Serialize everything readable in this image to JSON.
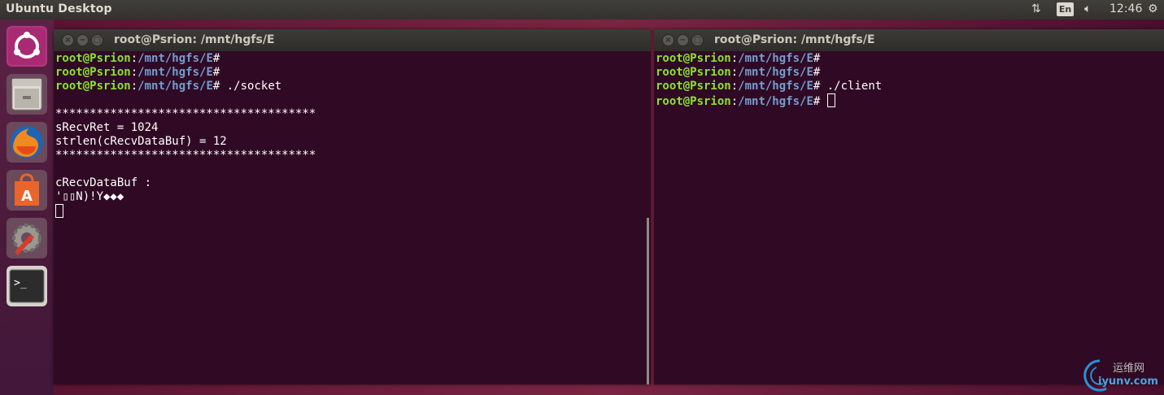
{
  "topbar": {
    "title": "Ubuntu Desktop",
    "keyboard_layout": "En",
    "clock": "12:46",
    "icons": [
      "network-arrows-icon",
      "volume-icon",
      "gear-icon"
    ]
  },
  "launcher": {
    "items": [
      {
        "name": "ubuntu-dash-icon"
      },
      {
        "name": "files-icon"
      },
      {
        "name": "firefox-icon"
      },
      {
        "name": "software-center-icon"
      },
      {
        "name": "system-settings-icon"
      },
      {
        "name": "terminal-icon"
      }
    ]
  },
  "left_terminal": {
    "title": "root@Psrion: /mnt/hgfs/E",
    "prompt_user": "root@Psrion",
    "prompt_sep": ":",
    "prompt_path": "/mnt/hgfs/E",
    "prompt_end": "#",
    "lines": [
      {
        "prompt": true,
        "cmd": ""
      },
      {
        "prompt": true,
        "cmd": ""
      },
      {
        "prompt": true,
        "cmd": " ./socket"
      },
      {
        "prompt": false,
        "text": ""
      },
      {
        "prompt": false,
        "text": "**************************************"
      },
      {
        "prompt": false,
        "text": "sRecvRet = 1024"
      },
      {
        "prompt": false,
        "text": "strlen(cRecvDataBuf) = 12"
      },
      {
        "prompt": false,
        "text": "**************************************"
      },
      {
        "prompt": false,
        "text": ""
      },
      {
        "prompt": false,
        "text": "cRecvDataBuf :"
      },
      {
        "prompt": false,
        "text": "'▯▯N)!Y◆◆◆"
      },
      {
        "prompt": false,
        "text": ""
      }
    ]
  },
  "right_terminal": {
    "title": "root@Psrion: /mnt/hgfs/E",
    "prompt_user": "root@Psrion",
    "prompt_sep": ":",
    "prompt_path": "/mnt/hgfs/E",
    "prompt_end": "#",
    "lines": [
      {
        "prompt": true,
        "cmd": ""
      },
      {
        "prompt": true,
        "cmd": ""
      },
      {
        "prompt": true,
        "cmd": " ./client"
      },
      {
        "prompt": true,
        "cmd": " "
      }
    ]
  },
  "watermark": {
    "cn": "运维网",
    "en": "iyunv.com"
  }
}
